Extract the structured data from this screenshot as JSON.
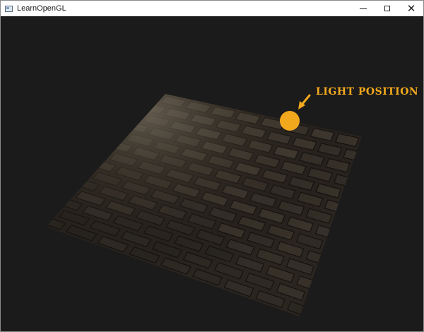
{
  "window": {
    "title": "LearnOpenGL",
    "app_icon": "window-app-icon",
    "controls": {
      "minimize_icon": "minimize-icon",
      "maximize_icon": "maximize-icon",
      "close_icon": "close-icon"
    }
  },
  "scene": {
    "background_color": "#1b1b1b",
    "surface": "stone-brick-floor",
    "light_color": "#f2a81d",
    "annotation": {
      "label": "LIGHT POSITION",
      "arrow_icon": "arrow-down-left-icon"
    }
  }
}
